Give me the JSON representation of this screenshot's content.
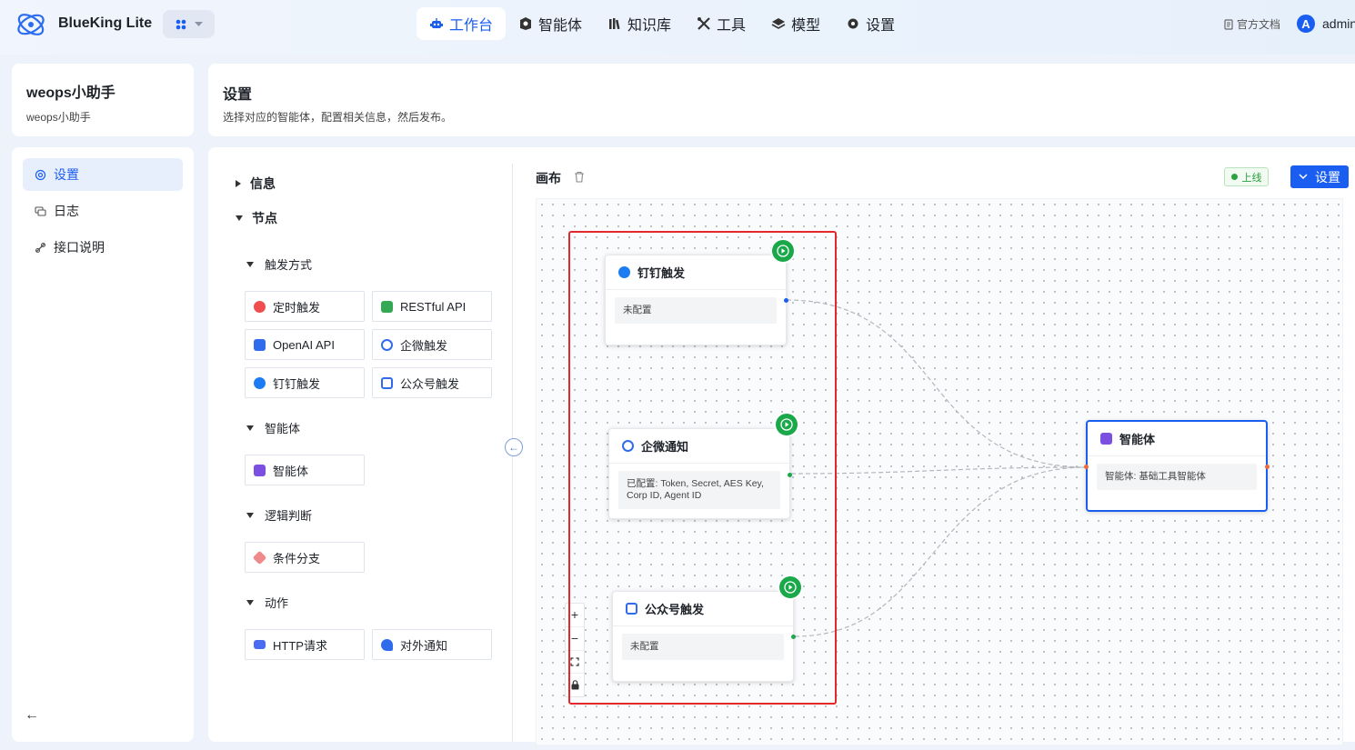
{
  "app": {
    "brand": "BlueKing Lite",
    "user_initial": "A",
    "user_name": "admin",
    "docs_label": "官方文档"
  },
  "nav": [
    {
      "label": "工作台",
      "icon": "robot-icon",
      "active": true
    },
    {
      "label": "智能体",
      "icon": "agent-icon",
      "active": false
    },
    {
      "label": "知识库",
      "icon": "library-icon",
      "active": false
    },
    {
      "label": "工具",
      "icon": "tools-icon",
      "active": false
    },
    {
      "label": "模型",
      "icon": "layers-icon",
      "active": false
    },
    {
      "label": "设置",
      "icon": "gear-icon",
      "active": false
    }
  ],
  "agent": {
    "name": "weops小助手",
    "subtitle": "weops小助手"
  },
  "page": {
    "title": "设置",
    "description": "选择对应的智能体，配置相关信息，然后发布。"
  },
  "sidebar": {
    "items": [
      {
        "label": "设置",
        "icon": "settings-icon",
        "active": true
      },
      {
        "label": "日志",
        "icon": "chat-log-icon",
        "active": false
      },
      {
        "label": "接口说明",
        "icon": "api-link-icon",
        "active": false
      }
    ]
  },
  "panel": {
    "info_label": "信息",
    "nodes_label": "节点",
    "groups": {
      "trigger": {
        "label": "触发方式",
        "items": [
          "定时触发",
          "RESTful API",
          "OpenAI API",
          "企微触发",
          "钉钉触发",
          "公众号触发"
        ]
      },
      "agent": {
        "label": "智能体",
        "items": [
          "智能体"
        ]
      },
      "logic": {
        "label": "逻辑判断",
        "items": [
          "条件分支"
        ]
      },
      "action": {
        "label": "动作",
        "items": [
          "HTTP请求",
          "对外通知"
        ]
      }
    }
  },
  "canvas": {
    "title": "画布",
    "status": "上线",
    "settings_button": "设置",
    "nodes": {
      "dingtalk": {
        "title": "钉钉触发",
        "body": "未配置"
      },
      "wecom": {
        "title": "企微通知",
        "body": "已配置: Token, Secret, AES Key, Corp ID, Agent ID"
      },
      "wechat_mp": {
        "title": "公众号触发",
        "body": "未配置"
      },
      "agent": {
        "title": "智能体",
        "body": "智能体: 基础工具智能体"
      }
    },
    "zoom_controls": [
      "+",
      "−"
    ]
  },
  "colors": {
    "accent": "#1a5df1",
    "success": "#19a84a",
    "highlight_box": "#e3282b"
  }
}
